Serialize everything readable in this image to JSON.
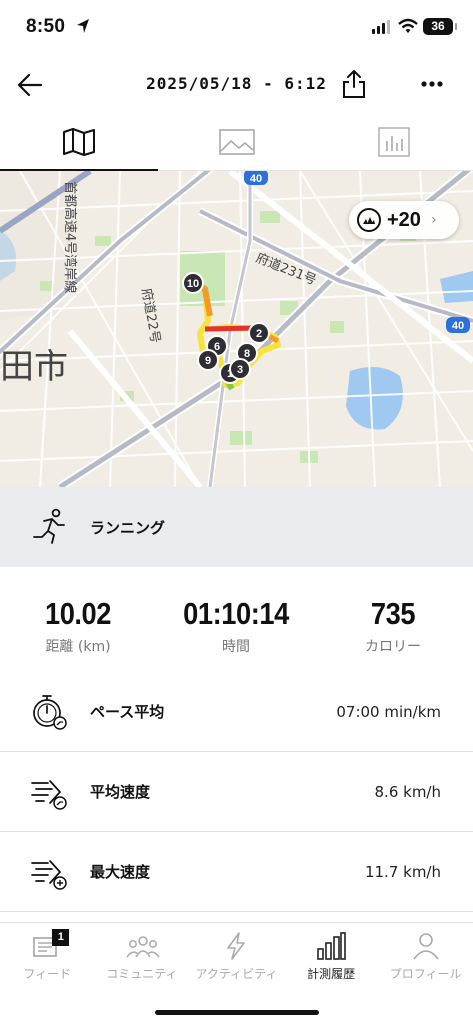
{
  "status": {
    "time": "8:50",
    "battery": "36"
  },
  "header": {
    "title": "2025/05/18 - 6:12"
  },
  "map": {
    "labels": [
      "首都高速4号湾岸線",
      "府道231号",
      "府道22号",
      "田市",
      "40",
      "40"
    ],
    "badge_count": "+20",
    "markers": [
      "10",
      "2",
      "6",
      "9",
      "8",
      "1",
      "3"
    ]
  },
  "activity": {
    "label": "ランニング"
  },
  "summary": [
    {
      "value": "10.02",
      "label": "距離 (km)"
    },
    {
      "value": "01:10:14",
      "label": "時間"
    },
    {
      "value": "735",
      "label": "カロリー"
    }
  ],
  "metrics": [
    {
      "label": "ペース平均",
      "value": "07:00 min/km",
      "icon": "stopwatch-icon"
    },
    {
      "label": "平均速度",
      "value": "8.6 km/h",
      "icon": "speed-average-icon"
    },
    {
      "label": "最大速度",
      "value": "11.7 km/h",
      "icon": "speed-max-icon"
    }
  ],
  "nav": [
    {
      "label": "フィード",
      "badge": "1",
      "icon": "feed-icon"
    },
    {
      "label": "コミュニティ",
      "icon": "community-icon"
    },
    {
      "label": "アクティビティ",
      "icon": "lightning-icon"
    },
    {
      "label": "計測履歴",
      "icon": "bar-chart-icon",
      "active": true
    },
    {
      "label": "プロフィール",
      "icon": "profile-icon"
    }
  ]
}
